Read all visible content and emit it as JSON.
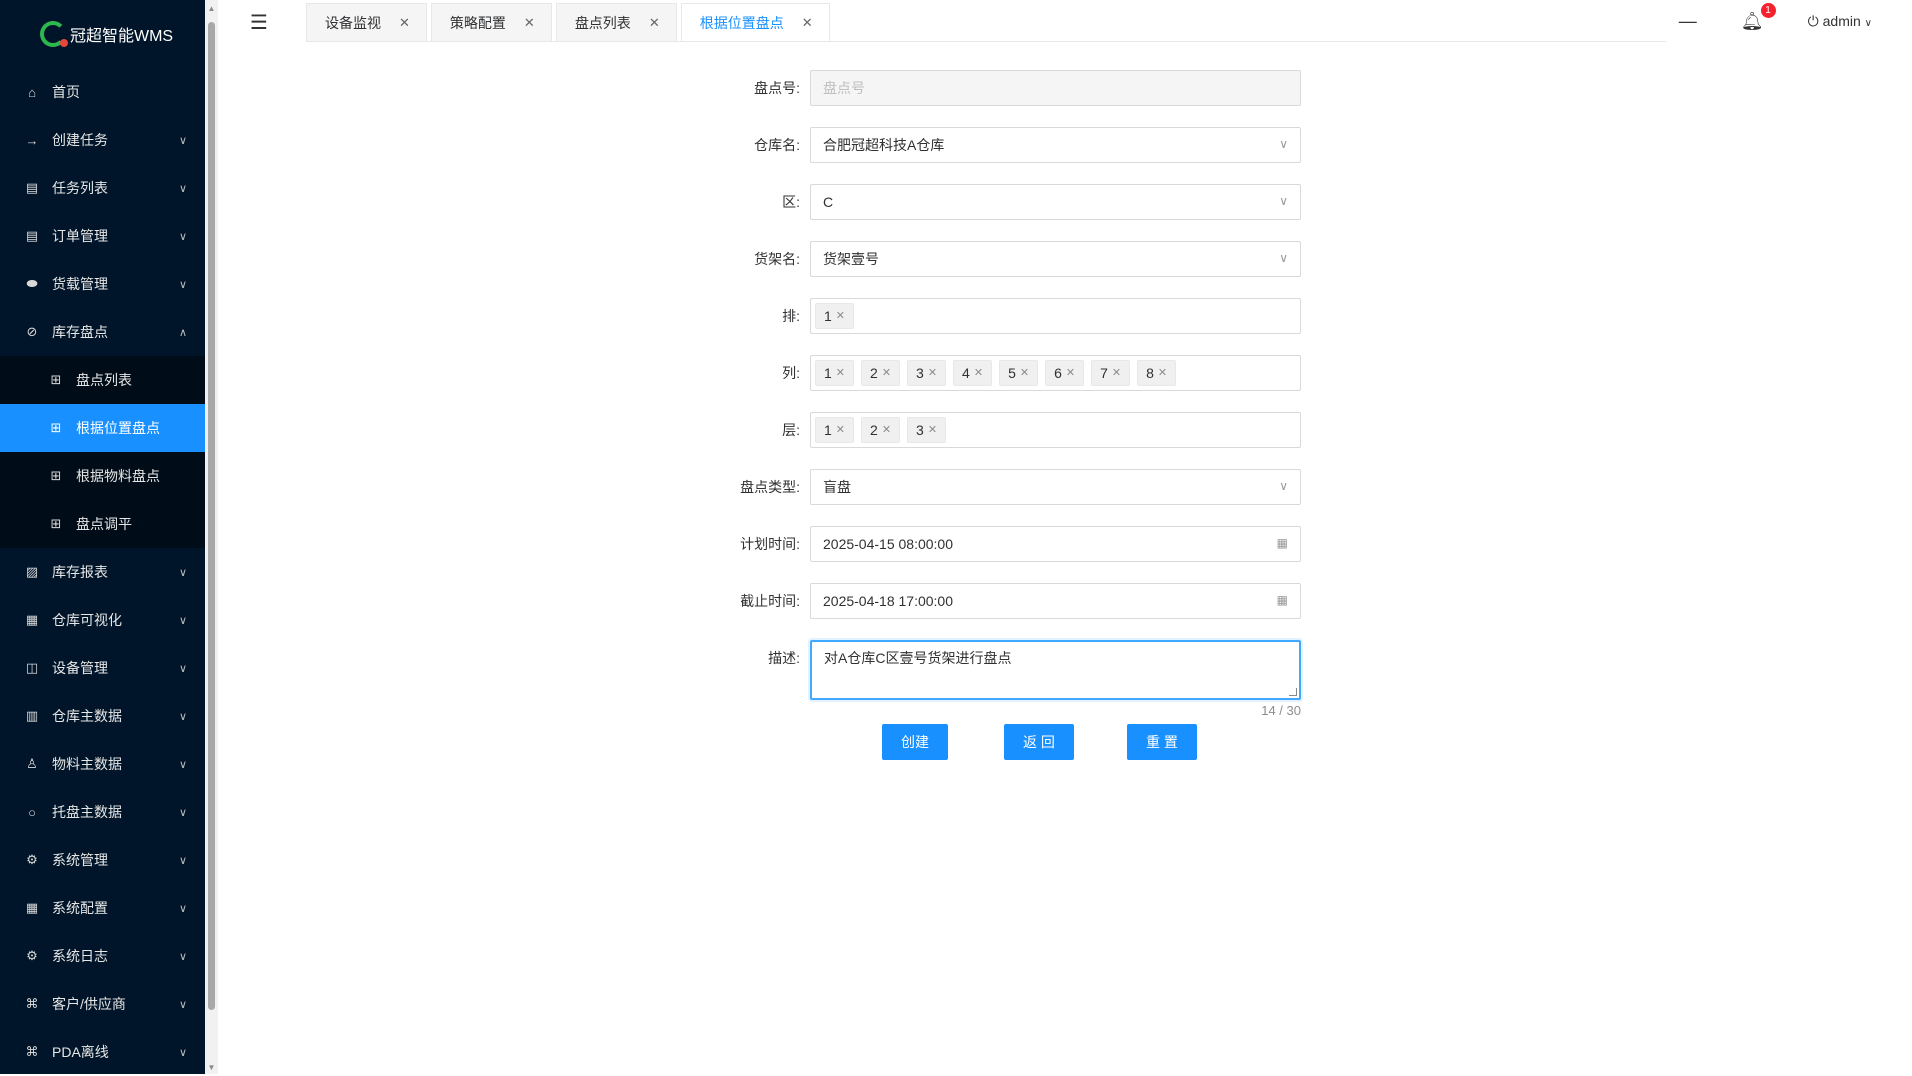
{
  "brand": {
    "title": "冠超智能WMS"
  },
  "sidebar": {
    "items": [
      {
        "label": "首页",
        "icon": "home-icon",
        "glyph": "⌂",
        "chevron": false
      },
      {
        "label": "创建任务",
        "icon": "arrow-right-icon",
        "glyph": "→",
        "chevron": true
      },
      {
        "label": "任务列表",
        "icon": "list-icon",
        "glyph": "▤",
        "chevron": true
      },
      {
        "label": "订单管理",
        "icon": "order-icon",
        "glyph": "▤",
        "chevron": true
      },
      {
        "label": "货载管理",
        "icon": "cargo-icon",
        "glyph": "⬬",
        "chevron": true
      },
      {
        "label": "库存盘点",
        "icon": "inventory-icon",
        "glyph": "⊘",
        "chevron": true,
        "expanded": true
      }
    ],
    "inventory_sub": [
      {
        "label": "盘点列表",
        "icon": "grid-icon"
      },
      {
        "label": "根据位置盘点",
        "icon": "grid-icon",
        "active": true
      },
      {
        "label": "根据物料盘点",
        "icon": "grid-icon"
      },
      {
        "label": "盘点调平",
        "icon": "grid-icon"
      }
    ],
    "items_after": [
      {
        "label": "库存报表",
        "icon": "report-icon",
        "glyph": "▨"
      },
      {
        "label": "仓库可视化",
        "icon": "grid-icon",
        "glyph": "▦"
      },
      {
        "label": "设备管理",
        "icon": "device-icon",
        "glyph": "◫"
      },
      {
        "label": "仓库主数据",
        "icon": "chart-icon",
        "glyph": "▥"
      },
      {
        "label": "物料主数据",
        "icon": "flask-icon",
        "glyph": "♙"
      },
      {
        "label": "托盘主数据",
        "icon": "circle-icon",
        "glyph": "○"
      },
      {
        "label": "系统管理",
        "icon": "settings-icon",
        "glyph": "⚙"
      },
      {
        "label": "系统配置",
        "icon": "apps-icon",
        "glyph": "▦"
      },
      {
        "label": "系统日志",
        "icon": "log-icon",
        "glyph": "⚙"
      },
      {
        "label": "客户/供应商",
        "icon": "command-icon",
        "glyph": "⌘"
      },
      {
        "label": "PDA离线",
        "icon": "command-icon",
        "glyph": "⌘"
      }
    ]
  },
  "tabs": [
    {
      "label": "设备监视"
    },
    {
      "label": "策略配置"
    },
    {
      "label": "盘点列表"
    },
    {
      "label": "根据位置盘点",
      "active": true
    }
  ],
  "header": {
    "notification_count": "1",
    "user": "admin"
  },
  "form": {
    "count_no": {
      "label": "盘点号:",
      "placeholder": "盘点号"
    },
    "warehouse": {
      "label": "仓库名:",
      "value": "合肥冠超科技A仓库"
    },
    "zone": {
      "label": "区:",
      "value": "C"
    },
    "shelf": {
      "label": "货架名:",
      "value": "货架壹号"
    },
    "row": {
      "label": "排:",
      "tags": [
        "1"
      ]
    },
    "column": {
      "label": "列:",
      "tags": [
        "1",
        "2",
        "3",
        "4",
        "5",
        "6",
        "7",
        "8"
      ]
    },
    "layer": {
      "label": "层:",
      "tags": [
        "1",
        "2",
        "3"
      ]
    },
    "count_type": {
      "label": "盘点类型:",
      "value": "盲盘"
    },
    "plan_time": {
      "label": "计划时间:",
      "value": "2025-04-15 08:00:00"
    },
    "deadline": {
      "label": "截止时间:",
      "value": "2025-04-18 17:00:00"
    },
    "description": {
      "label": "描述:",
      "value": "对A仓库C区壹号货架进行盘点",
      "counter": "14 / 30"
    }
  },
  "buttons": {
    "create": "创建",
    "back": "返 回",
    "reset": "重 置"
  },
  "colors": {
    "sidebar_bg": "#001529",
    "accent": "#1890ff",
    "badge": "#f5222d"
  }
}
